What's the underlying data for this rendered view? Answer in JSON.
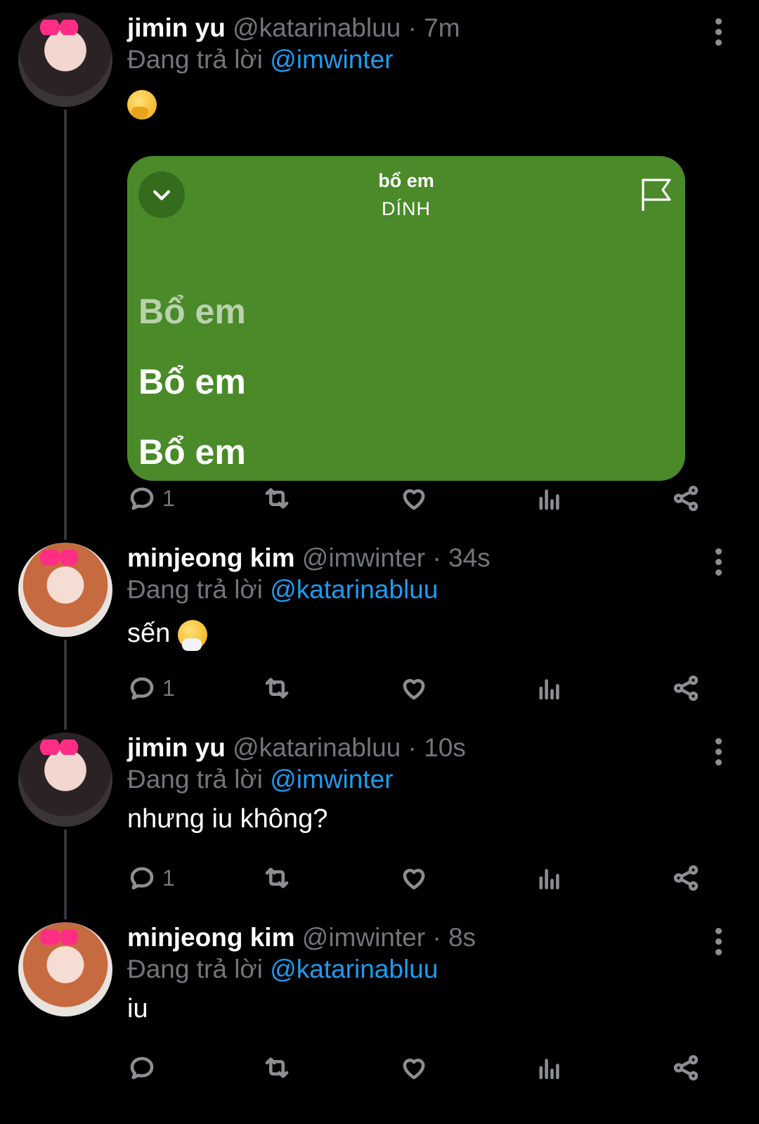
{
  "tweets": [
    {
      "name": "jimin yu",
      "handle": "@katarinabluu",
      "sep": " · ",
      "time": "7m",
      "reply_prefix": "Đang trả lời ",
      "reply_to": "@imwinter",
      "text_emoji": "face-with-hand-over-mouth",
      "replies": "1"
    },
    {
      "name": "minjeong kim",
      "handle": "@imwinter",
      "sep": " · ",
      "time": "34s",
      "reply_prefix": "Đang trả lời ",
      "reply_to": "@katarinabluu",
      "text": "sến ",
      "text_emoji": "sneezing-face",
      "replies": "1"
    },
    {
      "name": "jimin yu",
      "handle": "@katarinabluu",
      "sep": " · ",
      "time": "10s",
      "reply_prefix": "Đang trả lời ",
      "reply_to": "@imwinter",
      "text": "nhưng iu không?",
      "replies": "1"
    },
    {
      "name": "minjeong kim",
      "handle": "@imwinter",
      "sep": " · ",
      "time": "8s",
      "reply_prefix": "Đang trả lời ",
      "reply_to": "@katarinabluu",
      "text": "iu",
      "replies": ""
    }
  ],
  "card": {
    "song_title": "bổ em",
    "artist": "DÍNH",
    "lyrics": [
      "Bổ em",
      "Bổ em",
      "Bổ em"
    ],
    "background": "#4a8a29",
    "icons": [
      "chevron-down-icon",
      "flag-icon"
    ]
  },
  "icons": [
    "reply-icon",
    "retweet-icon",
    "like-icon",
    "views-icon",
    "share-icon",
    "more-icon"
  ],
  "colors": {
    "mention": "#1d9bf0",
    "meta": "#71767b",
    "background": "#000000"
  }
}
